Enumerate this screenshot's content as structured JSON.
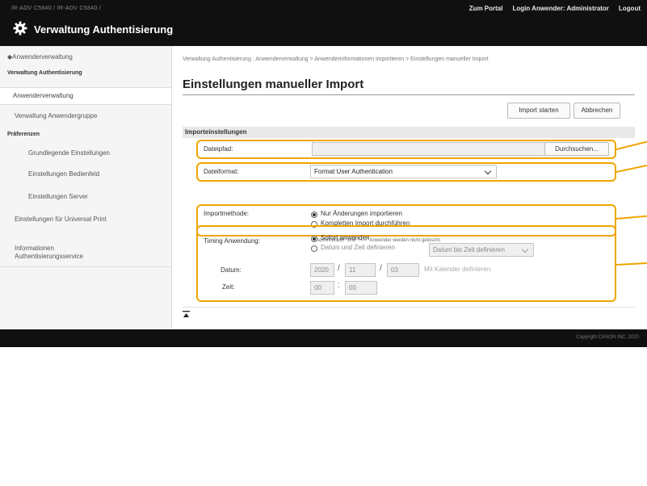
{
  "header": {
    "device_name": "IR-ADV C5840 / IR-ADV C5840 /",
    "portal_link": "Zum Portal",
    "login_user": "Login Anwender:",
    "user_name": "Administrator",
    "logout": "Logout",
    "app_title": "Verwaltung Authentisierung",
    "app_icon": "gear-icon"
  },
  "sidebar": {
    "back": "Anwenderverwaltung",
    "section1": "Verwaltung Authentisierung",
    "selected": "Anwenderverwaltung",
    "group_mgmt": "Verwaltung Anwendergruppe",
    "section2": "Präferenzen",
    "items": [
      "Grundlegende Einstellungen",
      "Einstellungen Bedienfeld",
      "Einstellungen Server"
    ],
    "universal_print": "Einstellungen für Universal Print",
    "info_service": "Informationen Authentisierungsservice"
  },
  "main": {
    "breadcrumb": "Verwaltung Authentisierung : Anwenderverwaltung > Anwenderinformationen importieren > Einstellungen manueller Import",
    "title": "Einstellungen manueller Import",
    "start_button": "Import starten",
    "cancel_button": "Abbrechen",
    "section_title": "Importeinstellungen",
    "file_path_label": "Dateipfad:",
    "file_path_value": "",
    "browse_button": "Durchsuchen...",
    "file_format_label": "Dateiformat:",
    "file_format_value": "Format User Authentication",
    "import_method_label": "Importmethode:",
    "import_options": [
      "Nur Änderungen importieren",
      "Kompletten Import durchführen"
    ],
    "import_selected": 0,
    "import_note": "* \"Administrator\" und \"-----\" Anwender werden nicht gelöscht.",
    "timing_label": "Timing Anwendung:",
    "timing_options": [
      "Sofort anwenden",
      "Datum und Zeit definieren"
    ],
    "timing_selected": 0,
    "timing_select_value": "Datum bis Zeit definieren",
    "date_label": "Datum:",
    "date_year": "2020",
    "date_month": "11",
    "date_day": "03",
    "calendar_link": "Mit Kalender definieren",
    "time_label": "Zeit:",
    "time_hour": "00",
    "time_minute": "00",
    "time_sep": ":",
    "date_sep": "/"
  },
  "footer": {
    "copyright": "Copyright CANON INC. 2020",
    "top_icon": "scroll-to-top-icon"
  },
  "colors": {
    "highlight": "#f0a500",
    "header_bg": "#101010"
  }
}
